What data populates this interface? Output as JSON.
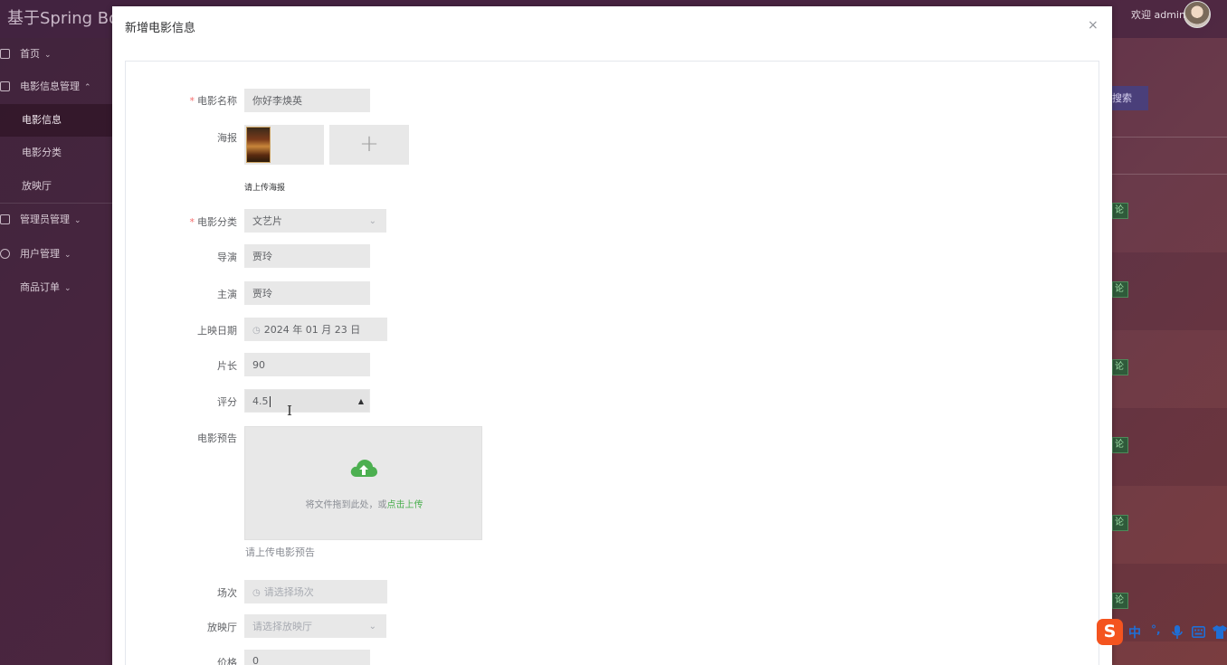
{
  "app": {
    "title": "基于Spring Boo",
    "welcome": "欢迎 admin"
  },
  "sidebar": {
    "items": [
      {
        "label": "首页",
        "chevron": "⌄"
      },
      {
        "label": "电影信息管理",
        "chevron": "⌃"
      },
      {
        "label": "电影信息"
      },
      {
        "label": "电影分类"
      },
      {
        "label": "放映厅"
      },
      {
        "label": "管理员管理",
        "chevron": "⌄"
      },
      {
        "label": "用户管理",
        "chevron": "⌄"
      },
      {
        "label": "商品订单",
        "chevron": "⌄"
      }
    ]
  },
  "background": {
    "search_label": "搜索",
    "row_tag": "论"
  },
  "dialog": {
    "title": "新增电影信息",
    "close": "×",
    "fields": {
      "name": {
        "label": "电影名称",
        "value": "你好李焕英"
      },
      "poster": {
        "label": "海报",
        "add": "+",
        "hint": "请上传海报"
      },
      "category": {
        "label": "电影分类",
        "value": "文艺片"
      },
      "director": {
        "label": "导演",
        "value": "贾玲"
      },
      "cast": {
        "label": "主演",
        "value": "贾玲"
      },
      "release_date": {
        "label": "上映日期",
        "value": "2024 年 01 月 23 日"
      },
      "duration": {
        "label": "片长",
        "value": "90"
      },
      "rating": {
        "label": "评分",
        "value": "4.5"
      },
      "trailer": {
        "label": "电影预告",
        "drop_text": "将文件拖到此处，或",
        "drop_link": "点击上传",
        "hint": "请上传电影预告"
      },
      "session": {
        "label": "场次",
        "placeholder": "请选择场次"
      },
      "hall": {
        "label": "放映厅",
        "placeholder": "请选择放映厅"
      },
      "price": {
        "label": "价格",
        "value": "0"
      }
    }
  },
  "ime": {
    "logo": "S",
    "mode": "中",
    "punct": "°,"
  },
  "colors": {
    "accent_green": "#4caf50",
    "required_red": "#f56c6c",
    "ime_orange": "#f4541f"
  }
}
